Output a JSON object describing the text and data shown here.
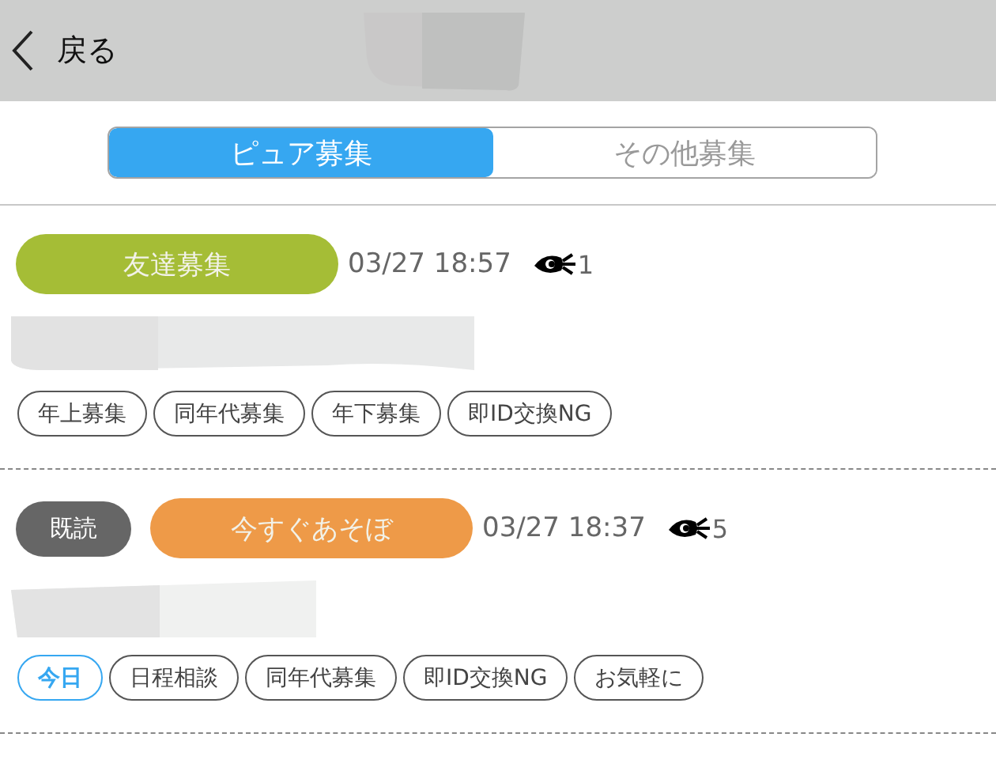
{
  "header": {
    "back_label": "戻る"
  },
  "tabs": [
    {
      "label": "ピュア募集",
      "selected": true
    },
    {
      "label": "その他募集",
      "selected": false
    }
  ],
  "posts": [
    {
      "category": "友達募集",
      "color": "#a5bd36",
      "datetime": "03/27 18:57",
      "views": "1",
      "tags": [
        {
          "label": "年上募集",
          "highlighted": false
        },
        {
          "label": "同年代募集",
          "highlighted": false
        },
        {
          "label": "年下募集",
          "highlighted": false
        },
        {
          "label": "即ID交換NG",
          "highlighted": false
        }
      ]
    },
    {
      "read_badge": "既読",
      "category": "今すぐあそぼ",
      "color": "#ee9a48",
      "datetime": "03/27 18:37",
      "views": "5",
      "tags": [
        {
          "label": "今日",
          "highlighted": true
        },
        {
          "label": "日程相談",
          "highlighted": false
        },
        {
          "label": "同年代募集",
          "highlighted": false
        },
        {
          "label": "即ID交換NG",
          "highlighted": false
        },
        {
          "label": "お気軽に",
          "highlighted": false
        }
      ]
    }
  ]
}
